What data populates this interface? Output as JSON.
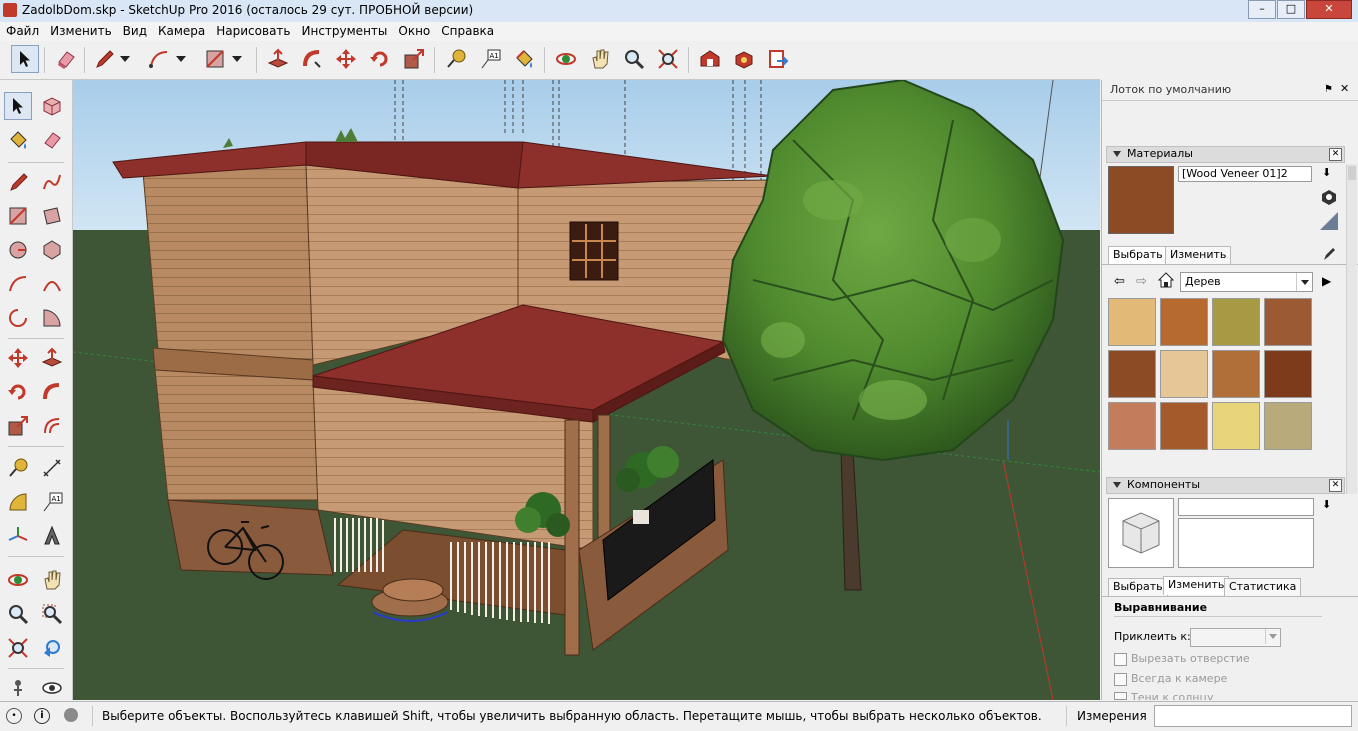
{
  "window": {
    "title": "ZadolbDom.skp - SketchUp Pro 2016 (осталось 29 сут. ПРОБНОЙ версии)",
    "minimize": "–",
    "maximize": "□",
    "close": "✕"
  },
  "menu": [
    "Файл",
    "Изменить",
    "Вид",
    "Камера",
    "Нарисовать",
    "Инструменты",
    "Окно",
    "Справка"
  ],
  "toolbar_icons": [
    "select-icon",
    "eraser-icon",
    "pencil-icon",
    "arc-icon",
    "rectangle-icon",
    "push-pull-icon",
    "follow-me-icon",
    "move-icon",
    "rotate-icon",
    "scale-icon",
    "tape-measure-icon",
    "text-icon",
    "paint-bucket-icon",
    "orbit-icon",
    "pan-icon",
    "zoom-icon",
    "zoom-extents-icon",
    "warehouse-icon",
    "extension-icon",
    "share-model-icon"
  ],
  "colors": {
    "sky_top": "#a8cdea",
    "sky_bottom": "#d6e8f5",
    "ground": "#3e5636",
    "roof": "#8d2f2a",
    "wall": "#c69a74",
    "tree": "#4f8a2e",
    "accent_red": "#c0392b"
  },
  "tray": {
    "title": "Лоток по умолчанию",
    "materials": {
      "header": "Материалы",
      "name": "[Wood Veneer 01]2",
      "tabs": [
        "Выбрать",
        "Изменить"
      ],
      "collection": "Дерев",
      "swatches": [
        "#e3b977",
        "#b66a30",
        "#a79a45",
        "#9b5a34",
        "#8c4a25",
        "#e6c597",
        "#b06f38",
        "#7d3b1c",
        "#c47d5c",
        "#a55a2c",
        "#e8d47a",
        "#b8aa7a"
      ]
    },
    "components": {
      "header": "Компоненты",
      "tabs": [
        "Выбрать",
        "Изменить",
        "Статистика"
      ],
      "section": "Выравнивание",
      "glue_label": "Приклеить к:",
      "options": [
        "Вырезать отверстие",
        "Всегда к камере",
        "Тени к солнцу"
      ]
    }
  },
  "status": {
    "message": "Выберите объекты. Воспользуйтесь клавишей Shift, чтобы увеличить выбранную область. Перетащите мышь, чтобы выбрать несколько объектов.",
    "measurements_label": "Измерения"
  }
}
